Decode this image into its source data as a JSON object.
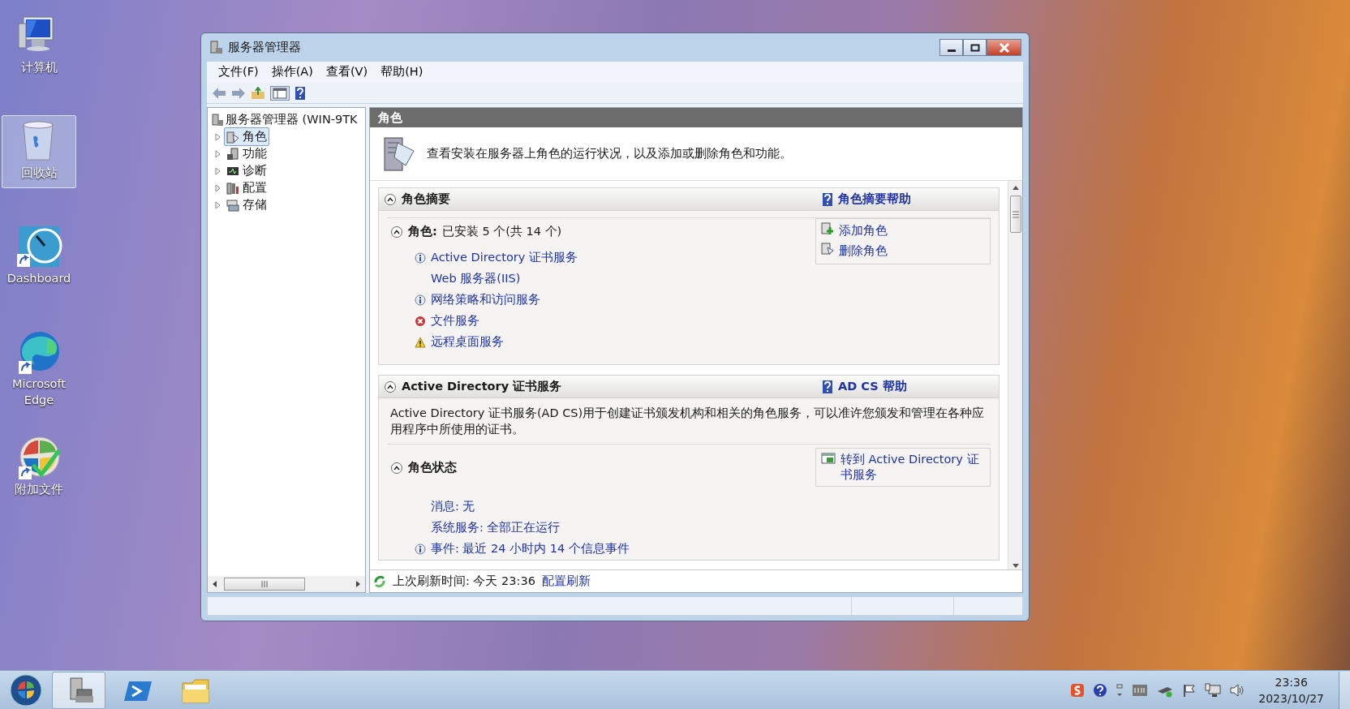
{
  "desktop_icons": [
    {
      "kind": "computer",
      "label": "计算机",
      "selected": false
    },
    {
      "kind": "recycle-bin",
      "label": "回收站",
      "selected": true
    },
    {
      "kind": "dashboard",
      "label": "Dashboard",
      "selected": false
    },
    {
      "kind": "edge",
      "label": "Microsoft Edge",
      "selected": false
    },
    {
      "kind": "addon",
      "label": "附加文件",
      "selected": false
    }
  ],
  "window": {
    "title": "服务器管理器",
    "menu": [
      "文件(F)",
      "操作(A)",
      "查看(V)",
      "帮助(H)"
    ],
    "tree": {
      "root": "服务器管理器 (WIN-9TK",
      "items": [
        {
          "kind": "roles",
          "label": "角色",
          "selected": true,
          "expanded": false
        },
        {
          "kind": "features",
          "label": "功能",
          "selected": false,
          "expanded": false
        },
        {
          "kind": "diagnostics",
          "label": "诊断",
          "selected": false,
          "expanded": false
        },
        {
          "kind": "configuration",
          "label": "配置",
          "selected": false,
          "expanded": false
        },
        {
          "kind": "storage",
          "label": "存储",
          "selected": false,
          "expanded": false
        }
      ]
    },
    "pane_title": "角色",
    "intro": "查看安装在服务器上角色的运行状况，以及添加或删除角色和功能。",
    "summary": {
      "title": "角色摘要",
      "expanded": true,
      "help": "角色摘要帮助",
      "sub_label": "角色:",
      "sub_value": "已安装 5 个(共 14 个)",
      "sub_expanded": true,
      "roles": [
        {
          "name": "Active Directory 证书服务",
          "kind": "info"
        },
        {
          "name": "Web 服务器(IIS)",
          "kind": "plain"
        },
        {
          "name": "网络策略和访问服务",
          "kind": "info"
        },
        {
          "name": "文件服务",
          "kind": "error"
        },
        {
          "name": "远程桌面服务",
          "kind": "warning"
        }
      ],
      "actions": [
        {
          "kind": "add",
          "label": "添加角色"
        },
        {
          "kind": "remove",
          "label": "删除角色"
        }
      ]
    },
    "adcs": {
      "title": "Active Directory 证书服务",
      "expanded": true,
      "help": "AD CS 帮助",
      "description": "Active Directory 证书服务(AD CS)用于创建证书颁发机构和相关的角色服务，可以准许您颁发和管理在各种应用程序中所使用的证书。",
      "sub_label": "角色状态",
      "sub_expanded": true,
      "action": "转到 Active Directory 证书服务",
      "status_lines": [
        {
          "text": "消息: 无",
          "kind": "plain"
        },
        {
          "text": "系统服务: 全部正在运行",
          "kind": "plain"
        },
        {
          "text": "事件: 最近 24 小时内 14 个信息事件",
          "kind": "info"
        }
      ]
    },
    "refresh": {
      "text": "上次刷新时间: 今天 23:36",
      "link": "配置刷新"
    }
  },
  "taskbar": {
    "apps": [
      {
        "kind": "server-manager",
        "selected": true
      },
      {
        "kind": "powershell",
        "selected": false
      },
      {
        "kind": "explorer",
        "selected": false
      }
    ],
    "clock": {
      "time": "23:36",
      "date": "2023/10/27"
    }
  }
}
